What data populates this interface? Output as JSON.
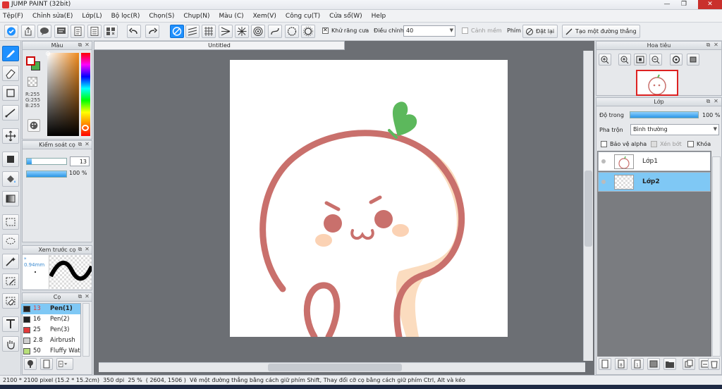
{
  "window": {
    "title": "JUMP PAINT (32bit)",
    "min": "—",
    "max": "❐",
    "close": "✕"
  },
  "menu": [
    "Tệp(F)",
    "Chỉnh sửa(E)",
    "Lớp(L)",
    "Bộ lọc(R)",
    "Chọn(S)",
    "Chụp(N)",
    "Màu (C)",
    "Xem(V)",
    "Công cụ(T)",
    "Cửa sổ(W)",
    "Help"
  ],
  "toolbar": {
    "antialias_label": "Khử răng cưa",
    "adjust_label": "Điều chỉnh",
    "adjust_value": "40",
    "warning_label": "Cảnh mềm",
    "key_label": "Phím",
    "reset_label": "Đặt lại",
    "straight_line_label": "Tạo một đường thẳng"
  },
  "color_panel": {
    "title": "Màu",
    "r": "R:255",
    "g": "G:255",
    "b": "B:255"
  },
  "brush_control": {
    "title": "Kiểm soát cọ",
    "size": "13",
    "opacity": "100 %",
    "size_fraction": 0.13,
    "opacity_fraction": 1.0
  },
  "preview": {
    "title": "Xem trước cọ",
    "size": "* 0.94mm"
  },
  "brush_panel": {
    "title": "Cọ",
    "items": [
      {
        "size": "13",
        "name": "Pen(1)",
        "color": "#222222",
        "selected": true
      },
      {
        "size": "16",
        "name": "Pen(2)",
        "color": "#222222",
        "selected": false
      },
      {
        "size": "25",
        "name": "Pen(3)",
        "color": "#e23a3a",
        "selected": false
      },
      {
        "size": "2.8",
        "name": "Airbrush",
        "color": "#cfcfcf",
        "selected": false
      },
      {
        "size": "50",
        "name": "Fluffy Wat",
        "color": "#b8e07a",
        "selected": false
      }
    ]
  },
  "document": {
    "tab": "Untitled"
  },
  "navigator": {
    "title": "Hoa tiêu"
  },
  "layers": {
    "title": "Lớp",
    "opacity_label": "Độ trong",
    "opacity_value": "100 %",
    "blend_label": "Pha trộn",
    "blend_value": "Bình thường",
    "protect_alpha": "Bảo vệ alpha",
    "clip": "Xén bớt",
    "lock": "Khóa",
    "items": [
      {
        "name": "Lớp1",
        "selected": false
      },
      {
        "name": "Lớp2",
        "selected": true
      }
    ]
  },
  "status": {
    "size": "2100 * 2100 pixel",
    "cm": "(15.2 * 15.2cm)",
    "dpi": "350 dpi",
    "zoom": "25 %",
    "coords": "( 2604, 1506 )",
    "hint": "Vẽ một đường thẳng bằng cách giữ phím Shift, Thay đổi cỡ cọ bằng cách giữ phím Ctrl, Alt và kéo"
  },
  "colors": {
    "accent": "#1e90ff",
    "selected_row": "#7fc8f5",
    "drawing_outline": "#c9706c",
    "leaf": "#5cb85c",
    "shade": "#fbdcbf"
  }
}
